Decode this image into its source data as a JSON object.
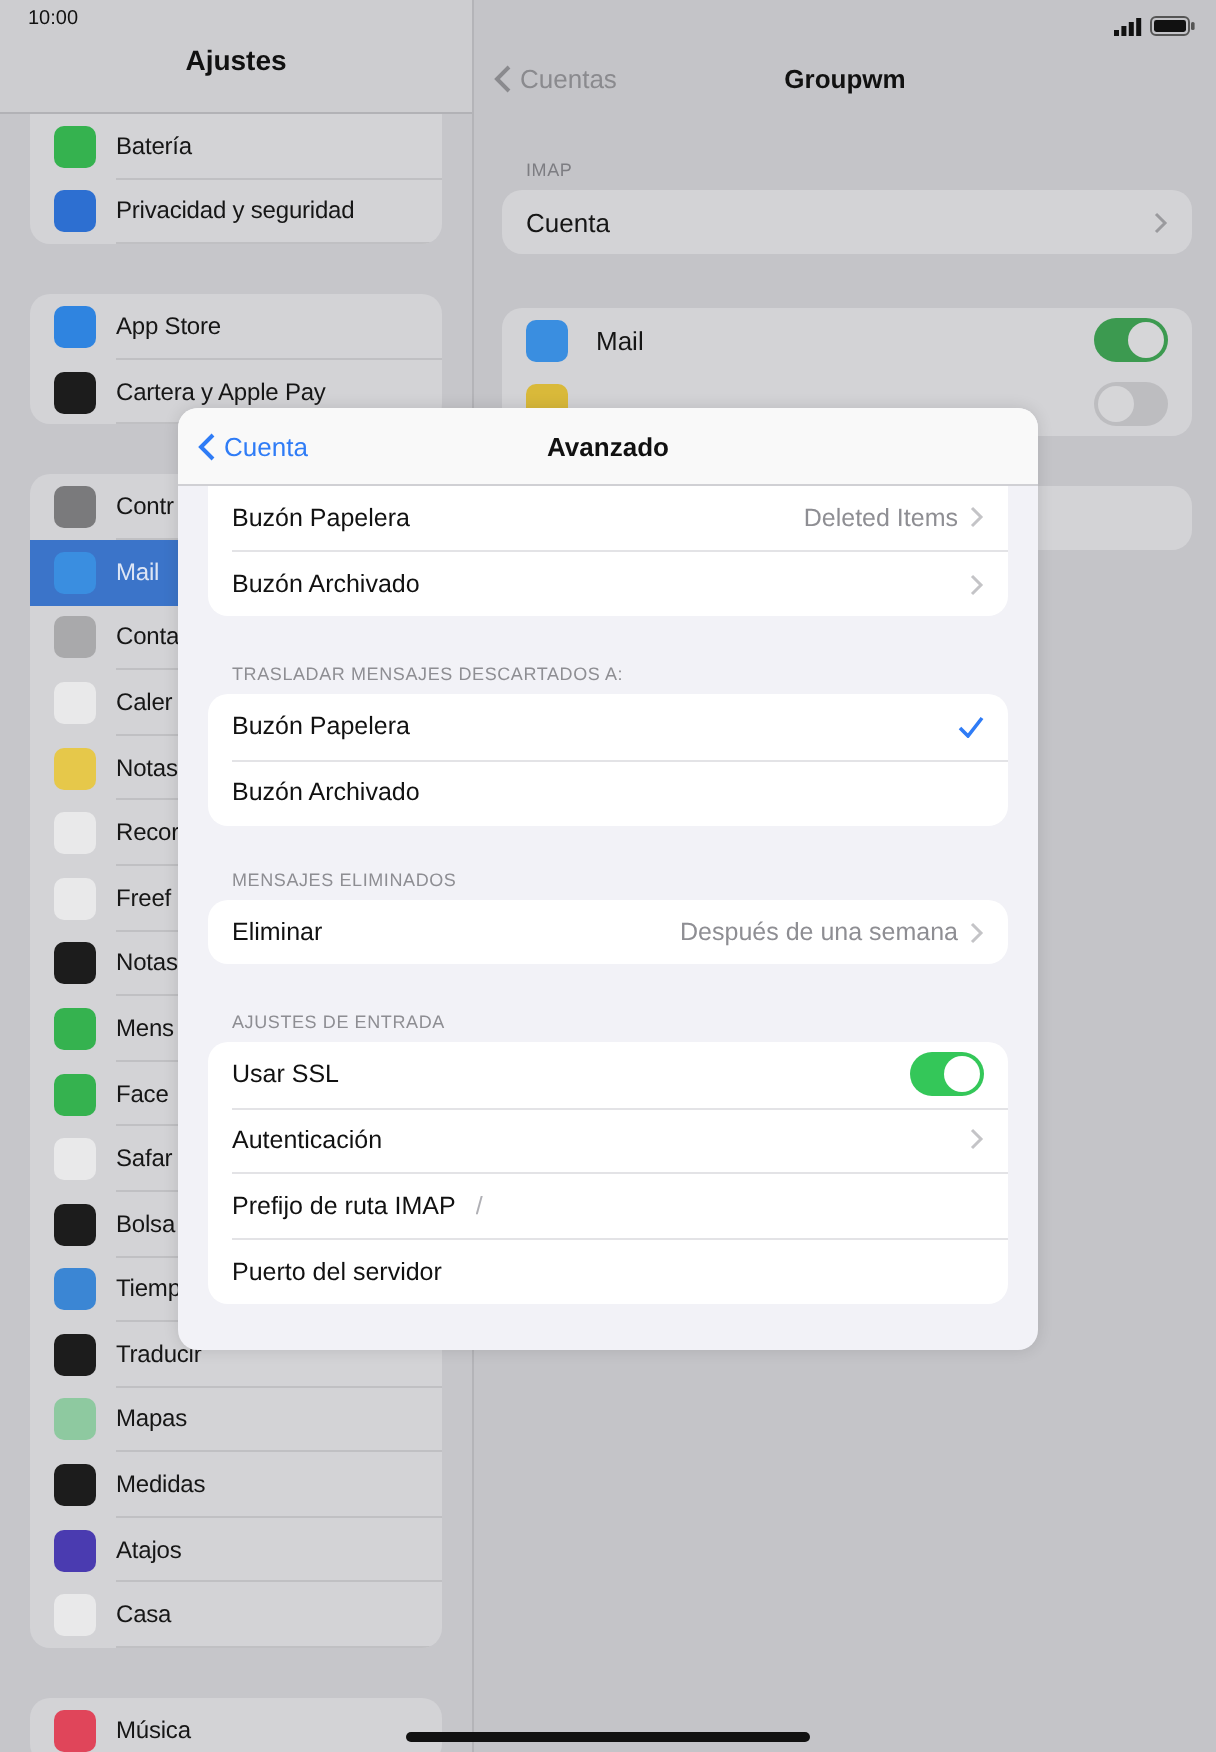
{
  "status_bar": {
    "time": "10:00"
  },
  "sidebar": {
    "title": "Ajustes",
    "groups": [
      [
        {
          "label": "Batería",
          "color": "#35b24f",
          "selected": false
        },
        {
          "label": "Privacidad y seguridad",
          "color": "#2d6fd1",
          "selected": false
        }
      ],
      [
        {
          "label": "App Store",
          "color": "#2f84e0",
          "selected": false
        },
        {
          "label": "Cartera y Apple Pay",
          "color": "#1c1c1c",
          "selected": false
        }
      ],
      [
        {
          "label": "Contr",
          "color": "#7a7a7c",
          "selected": false
        },
        {
          "label": "Mail",
          "color": "#3a8ee0",
          "selected": true
        },
        {
          "label": "Conta",
          "color": "#a9a9ab",
          "selected": false
        },
        {
          "label": "Caler",
          "color": "#e9e9ea",
          "selected": false
        },
        {
          "label": "Notas",
          "color": "#e6c84a",
          "selected": false
        },
        {
          "label": "Recor",
          "color": "#e9e9ea",
          "selected": false
        },
        {
          "label": "Freef",
          "color": "#e9e9ea",
          "selected": false
        },
        {
          "label": "Notas",
          "color": "#1c1c1c",
          "selected": false
        },
        {
          "label": "Mens",
          "color": "#35b24f",
          "selected": false
        },
        {
          "label": "Face",
          "color": "#35b24f",
          "selected": false
        },
        {
          "label": "Safar",
          "color": "#e9e9ea",
          "selected": false
        },
        {
          "label": "Bolsa",
          "color": "#1c1c1c",
          "selected": false
        },
        {
          "label": "Tiemp",
          "color": "#3b86d4",
          "selected": false
        },
        {
          "label": "Traducir",
          "color": "#1c1c1c",
          "selected": false
        },
        {
          "label": "Mapas",
          "color": "#8ec9a0",
          "selected": false
        },
        {
          "label": "Medidas",
          "color": "#1c1c1c",
          "selected": false
        },
        {
          "label": "Atajos",
          "color": "#4a3bb0",
          "selected": false
        },
        {
          "label": "Casa",
          "color": "#e9e9ea",
          "selected": false
        }
      ],
      [
        {
          "label": "Música",
          "color": "#e0455a",
          "selected": false
        }
      ]
    ]
  },
  "detail": {
    "back": "Cuentas",
    "title": "Groupwm",
    "section": "IMAP",
    "account_row": "Cuenta",
    "toggles": [
      {
        "label": "Mail",
        "color": "#3a8ee0",
        "on": true
      },
      {
        "color": "#d9b93a",
        "on": false
      }
    ]
  },
  "sheet": {
    "back": "Cuenta",
    "title": "Avanzado",
    "sections": [
      {
        "rows": [
          {
            "kind": "nav",
            "label": "Buzón Papelera",
            "value": "Deleted Items"
          },
          {
            "kind": "nav",
            "label": "Buzón Archivado"
          }
        ]
      },
      {
        "header": "TRASLADAR MENSAJES DESCARTADOS A:",
        "rows": [
          {
            "kind": "choice",
            "label": "Buzón Papelera",
            "selected": true
          },
          {
            "kind": "choice",
            "label": "Buzón Archivado",
            "selected": false
          }
        ]
      },
      {
        "header": "MENSAJES ELIMINADOS",
        "rows": [
          {
            "kind": "nav",
            "label": "Eliminar",
            "value": "Después de una semana"
          }
        ]
      },
      {
        "header": "AJUSTES DE ENTRADA",
        "rows": [
          {
            "kind": "toggle",
            "label": "Usar SSL",
            "on": true
          },
          {
            "kind": "nav",
            "label": "Autenticación"
          },
          {
            "kind": "field",
            "label": "Prefijo de ruta IMAP",
            "value": "/"
          },
          {
            "kind": "field",
            "label": "Puerto del servidor"
          }
        ]
      }
    ]
  }
}
